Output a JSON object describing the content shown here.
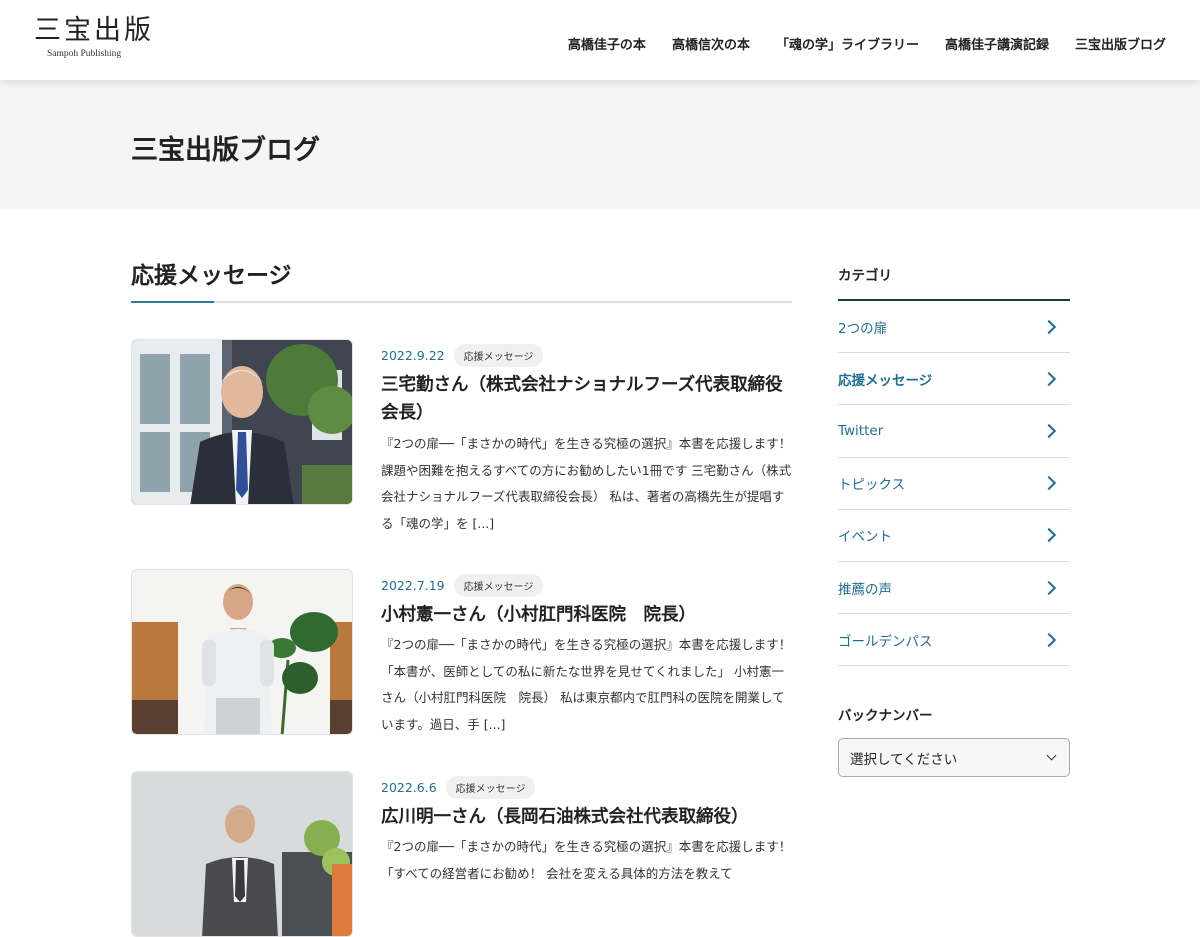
{
  "header": {
    "logo_main": "三宝出版",
    "logo_sub": "Sampoh Publishing",
    "nav": [
      "高橋佳子の本",
      "高橋信次の本",
      "「魂の学」ライブラリー",
      "高橋佳子講演記録",
      "三宝出版ブログ"
    ]
  },
  "page_title": "三宝出版ブログ",
  "section_title": "応援メッセージ",
  "posts": [
    {
      "date": "2022.9.22",
      "category": "応援メッセージ",
      "title": "三宅勤さん（株式会社ナショナルフーズ代表取締役会長）",
      "excerpt": "『2つの扉──「まさかの時代」を生きる究極の選択』本書を応援します！ 課題や困難を抱えるすべての方にお勧めしたい1冊です 三宅勤さん（株式会社ナショナルフーズ代表取締役会長） 私は、著者の高橋先生が提唱する「魂の学」を [...]"
    },
    {
      "date": "2022.7.19",
      "category": "応援メッセージ",
      "title": "小村憲一さん（小村肛門科医院　院長）",
      "excerpt": "『2つの扉──「まさかの時代」を生きる究極の選択』本書を応援します！ 「本書が、医師としての私に新たな世界を見せてくれました」 小村憲一さん（小村肛門科医院　院長） 私は東京都内で肛門科の医院を開業しています。過日、手 [...]"
    },
    {
      "date": "2022.6.6",
      "category": "応援メッセージ",
      "title": "広川明一さん（長岡石油株式会社代表取締役）",
      "excerpt": "『2つの扉──「まさかの時代」を生きる究極の選択』本書を応援します！ 「すべての経営者にお勧め！ 会社を変える具体的方法を教えて"
    }
  ],
  "sidebar": {
    "categories_heading": "カテゴリ",
    "categories": [
      {
        "label": "2つの扉"
      },
      {
        "label": "応援メッセージ"
      },
      {
        "label": "Twitter"
      },
      {
        "label": "トピックス"
      },
      {
        "label": "イベント"
      },
      {
        "label": "推薦の声"
      },
      {
        "label": "ゴールデンパス"
      }
    ],
    "back_number_heading": "バックナンバー",
    "select_placeholder": "選択してください"
  },
  "colors": {
    "accent": "#1f6e94",
    "header_bg": "#ffffff",
    "page_head_bg": "#f5f5f5"
  }
}
